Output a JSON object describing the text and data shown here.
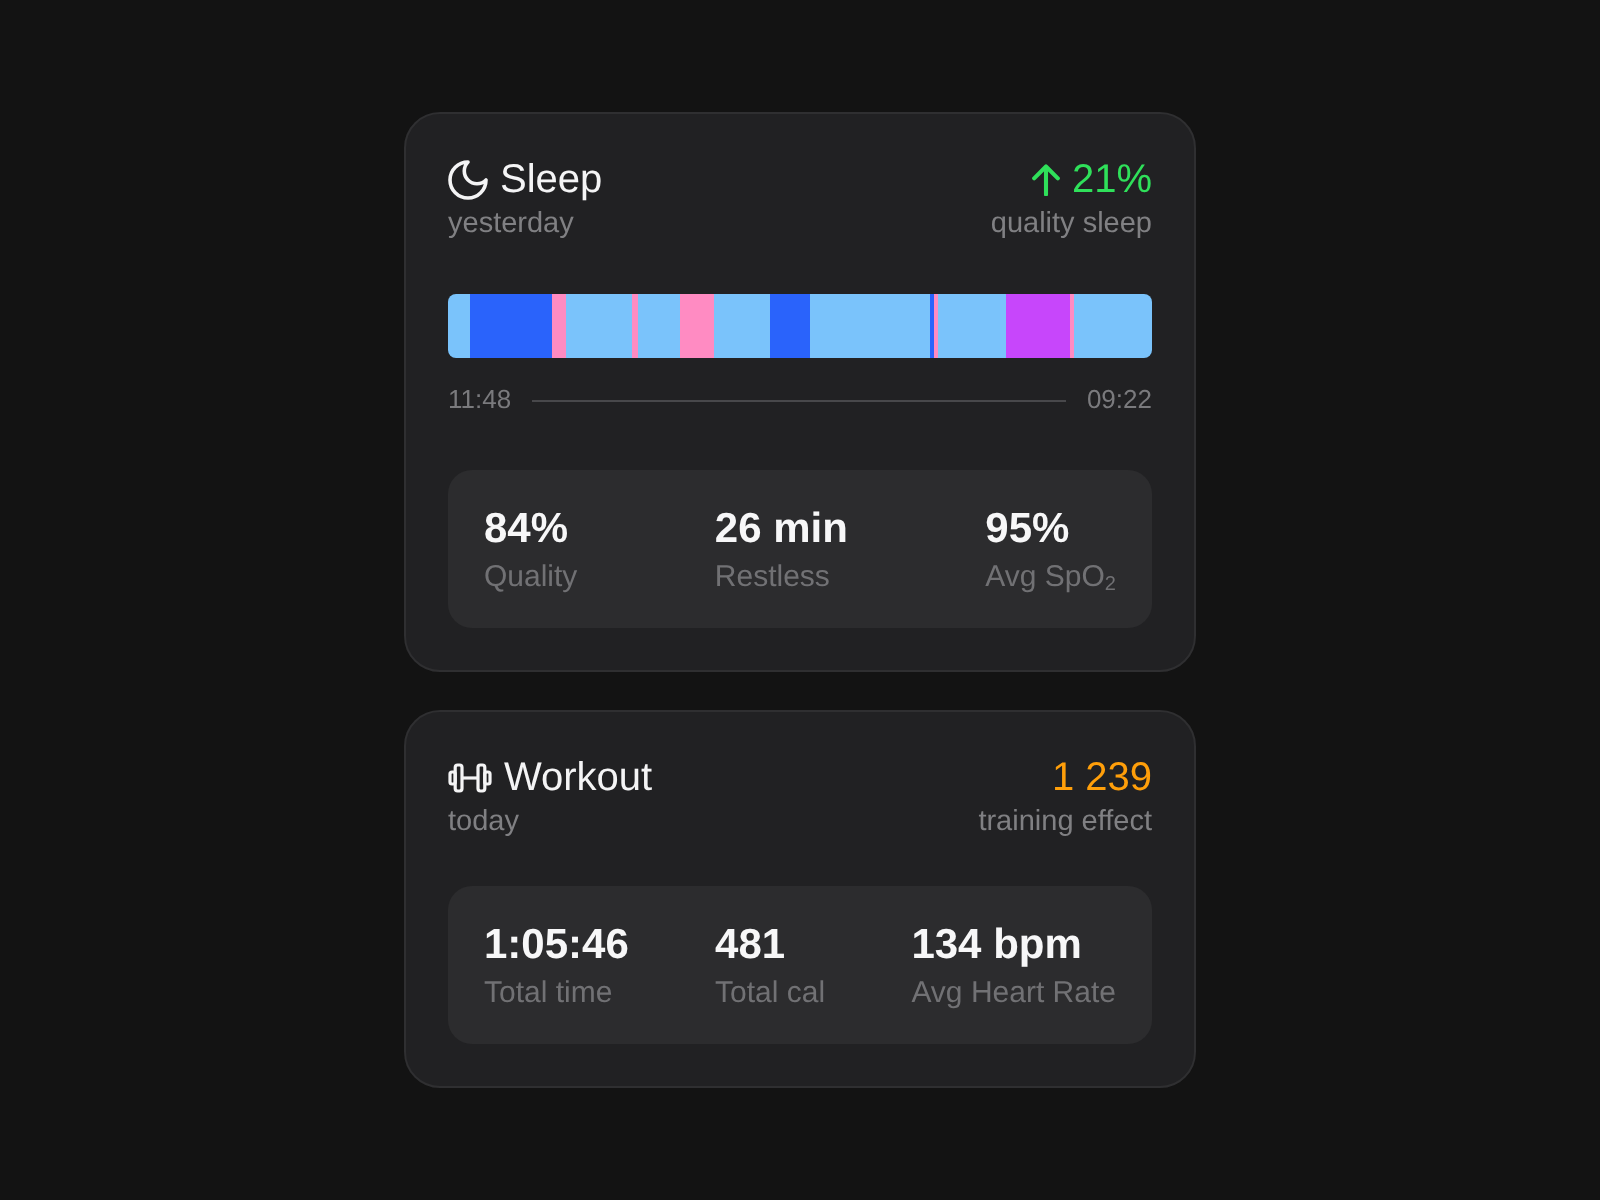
{
  "cards": [
    {
      "kind": "sleep",
      "title": "Sleep",
      "subtitle": "yesterday",
      "highlight": {
        "text": "21%",
        "rising": true,
        "color": "#2fe05a"
      },
      "highlight_label": "quality sleep",
      "timeline": {
        "start": "11:48",
        "end": "09:22"
      },
      "stats": [
        {
          "value": "84%",
          "label": "Quality"
        },
        {
          "value": "26 min",
          "label": "Restless"
        },
        {
          "value": "95%",
          "label": "Avg SpO$_{2}$"
        }
      ]
    },
    {
      "kind": "workout",
      "title": "Workout",
      "subtitle": "today",
      "highlight": {
        "text": "1 239",
        "color": "#ff9f0a"
      },
      "highlight_label": "training effect",
      "stats": [
        {
          "value": "1:05:46",
          "label": "Total time"
        },
        {
          "value": "481",
          "label": "Total cal"
        },
        {
          "value": "134 bpm",
          "label": "Avg Heart Rate"
        }
      ]
    }
  ]
}
